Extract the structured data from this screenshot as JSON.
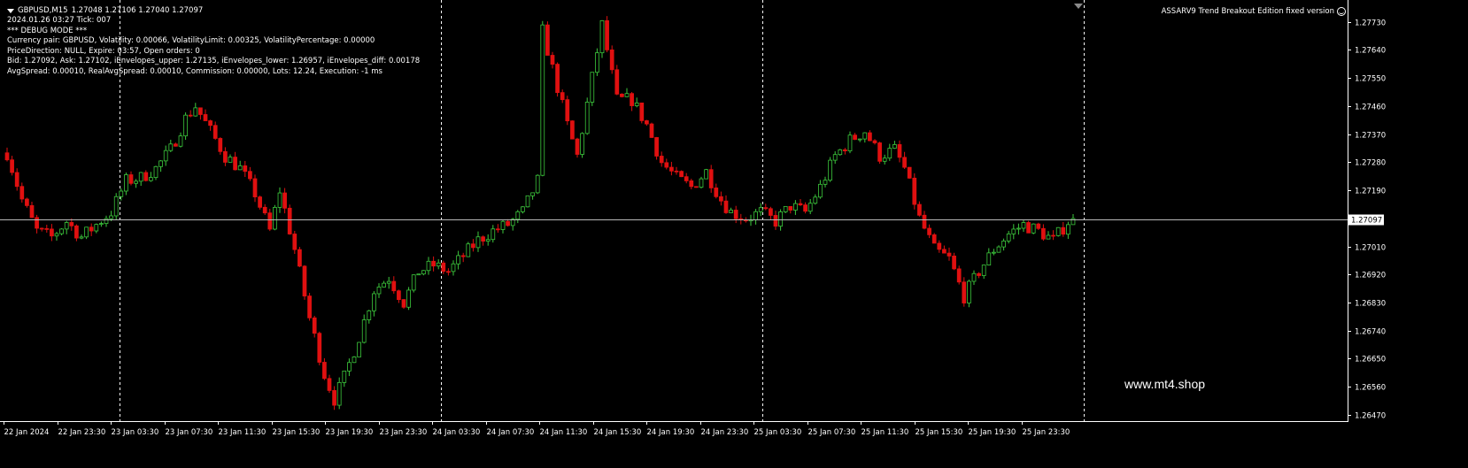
{
  "header": {
    "symbol": "GBPUSD,M15",
    "ohlc": "1.27048 1.27106 1.27040 1.27097"
  },
  "debug_lines": [
    "2024.01.26 03:27 Tick: 007",
    "*** DEBUG MODE ***",
    "Currency pair: GBPUSD, Volatility: 0.00066, VolatilityLimit: 0.00325, VolatilityPercentage: 0.00000",
    "PriceDirection: NULL, Expire: 03:57, Open orders: 0",
    "Bid: 1.27092, Ask: 1.27102, iEnvelopes_upper: 1.27135, iEnvelopes_lower: 1.26957, iEnvelopes_diff: 0.00178",
    "AvgSpread: 0.00010, RealAvgSpread: 0.00010, Commission: 0.00000, Lots: 12.24, Execution: -1 ms"
  ],
  "ea_name": "ASSARV9 Trend Breakout Edition fixed version",
  "watermark": "www.mt4.shop",
  "colors": {
    "background": "#000000",
    "bull": "#3cc83c",
    "bear": "#e01010",
    "axis": "#ffffff",
    "bid_line": "#b8b8b8",
    "separator": "#ffffff"
  },
  "chart_data": {
    "type": "candlestick",
    "price_labels": [
      "1.27730",
      "1.27640",
      "1.27550",
      "1.27460",
      "1.27370",
      "1.27280",
      "1.27190",
      "1.27010",
      "1.26920",
      "1.26830",
      "1.26740",
      "1.26650",
      "1.26560",
      "1.26470"
    ],
    "current_price": "1.27097",
    "ylim": [
      1.2645,
      1.278
    ],
    "time_labels": [
      "22 Jan 2024",
      "22 Jan 23:30",
      "23 Jan 03:30",
      "23 Jan 07:30",
      "23 Jan 11:30",
      "23 Jan 15:30",
      "23 Jan 19:30",
      "23 Jan 23:30",
      "24 Jan 03:30",
      "24 Jan 07:30",
      "24 Jan 11:30",
      "24 Jan 15:30",
      "24 Jan 19:30",
      "24 Jan 23:30",
      "25 Jan 03:30",
      "25 Jan 07:30",
      "25 Jan 11:30",
      "25 Jan 15:30",
      "25 Jan 19:30",
      "25 Jan 23:30"
    ],
    "day_separators": [
      "22 Jan 23:30",
      "23 Jan 23:30",
      "24 Jan 23:30",
      "25 Jan 23:30"
    ],
    "grid": false,
    "close_path": [
      [
        0,
        1.2731
      ],
      [
        3,
        1.2716
      ],
      [
        6,
        1.2706
      ],
      [
        9,
        1.2704
      ],
      [
        12,
        1.2709
      ],
      [
        15,
        1.2704
      ],
      [
        18,
        1.2708
      ],
      [
        21,
        1.2712
      ],
      [
        24,
        1.2722
      ],
      [
        27,
        1.2723
      ],
      [
        30,
        1.2726
      ],
      [
        33,
        1.2732
      ],
      [
        36,
        1.2742
      ],
      [
        38,
        1.2746
      ],
      [
        41,
        1.2738
      ],
      [
        44,
        1.273
      ],
      [
        47,
        1.2726
      ],
      [
        50,
        1.2718
      ],
      [
        53,
        1.2706
      ],
      [
        55,
        1.2719
      ],
      [
        58,
        1.27
      ],
      [
        61,
        1.2678
      ],
      [
        64,
        1.266
      ],
      [
        66,
        1.2652
      ],
      [
        68,
        1.2659
      ],
      [
        71,
        1.2672
      ],
      [
        74,
        1.2687
      ],
      [
        77,
        1.2691
      ],
      [
        80,
        1.2683
      ],
      [
        83,
        1.2693
      ],
      [
        86,
        1.2695
      ],
      [
        89,
        1.2693
      ],
      [
        92,
        1.2698
      ],
      [
        95,
        1.2703
      ],
      [
        98,
        1.2706
      ],
      [
        101,
        1.2708
      ],
      [
        104,
        1.2712
      ],
      [
        107,
        1.2722
      ],
      [
        108,
        1.277
      ],
      [
        110,
        1.2758
      ],
      [
        113,
        1.274
      ],
      [
        115,
        1.273
      ],
      [
        118,
        1.2755
      ],
      [
        120,
        1.2772
      ],
      [
        123,
        1.2748
      ],
      [
        126,
        1.2748
      ],
      [
        129,
        1.274
      ],
      [
        132,
        1.2728
      ],
      [
        135,
        1.2723
      ],
      [
        138,
        1.272
      ],
      [
        141,
        1.2725
      ],
      [
        144,
        1.2716
      ],
      [
        146,
        1.2712
      ],
      [
        149,
        1.271
      ],
      [
        152,
        1.2712
      ],
      [
        155,
        1.2709
      ],
      [
        158,
        1.2714
      ],
      [
        161,
        1.2712
      ],
      [
        164,
        1.272
      ],
      [
        167,
        1.273
      ],
      [
        170,
        1.2735
      ],
      [
        173,
        1.2738
      ],
      [
        176,
        1.273
      ],
      [
        179,
        1.2732
      ],
      [
        181,
        1.2726
      ],
      [
        184,
        1.271
      ],
      [
        187,
        1.27
      ],
      [
        190,
        1.2697
      ],
      [
        193,
        1.2685
      ],
      [
        196,
        1.2693
      ],
      [
        199,
        1.27
      ],
      [
        202,
        1.2705
      ],
      [
        205,
        1.2708
      ],
      [
        208,
        1.2706
      ],
      [
        211,
        1.2703
      ],
      [
        214,
        1.2709
      ]
    ]
  }
}
